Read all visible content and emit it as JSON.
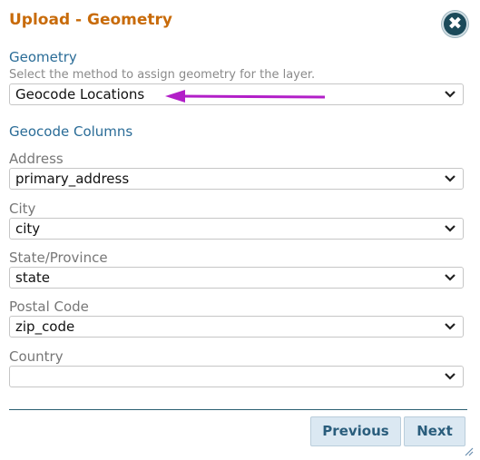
{
  "dialog": {
    "title": "Upload - Geometry",
    "close_symbol": "✖"
  },
  "geometry": {
    "label": "Geometry",
    "help": "Select the method to assign geometry for the layer.",
    "method_value": "Geocode Locations"
  },
  "geocode": {
    "section_label": "Geocode Columns",
    "fields": [
      {
        "label": "Address",
        "value": "primary_address"
      },
      {
        "label": "City",
        "value": "city"
      },
      {
        "label": "State/Province",
        "value": "state"
      },
      {
        "label": "Postal Code",
        "value": "zip_code"
      },
      {
        "label": "Country",
        "value": ""
      }
    ]
  },
  "buttons": {
    "previous": "Previous",
    "next": "Next"
  },
  "colors": {
    "title": "#c86b0a",
    "section": "#2a6c97",
    "annotation_arrow": "#b21fc8",
    "close_button": "#1b4a5a"
  },
  "icons": {
    "close": "close-icon",
    "dropdown": "chevron-down-icon",
    "annotation": "arrow-left-icon",
    "resize": "resize-grip-icon"
  }
}
